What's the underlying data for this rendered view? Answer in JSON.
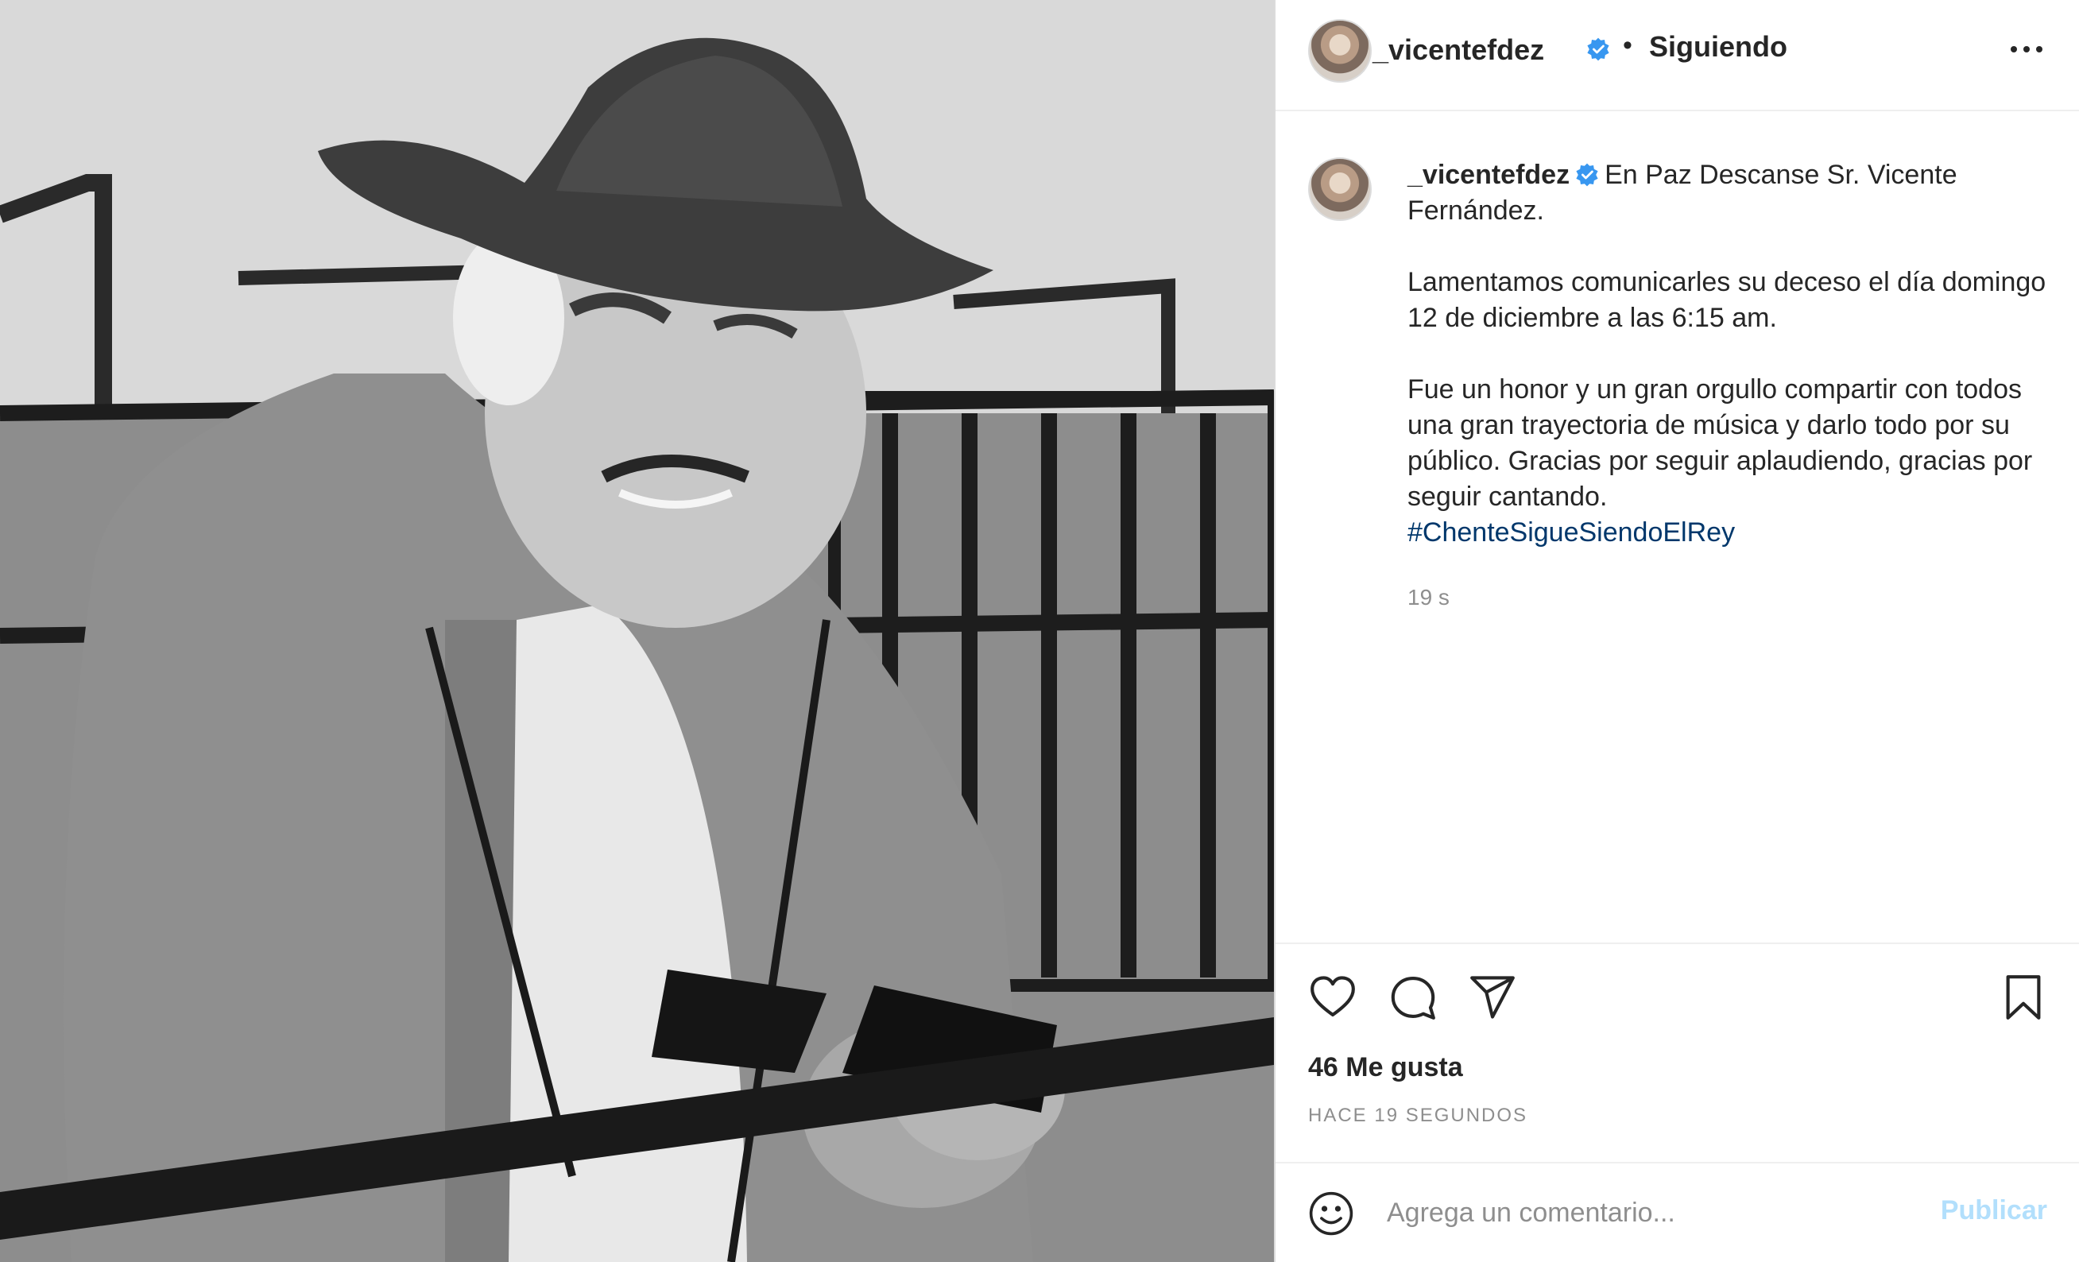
{
  "photo": {
    "alt": ""
  },
  "header": {
    "username": "_vicentefdez",
    "separator": "•",
    "follow_status": "Siguiendo"
  },
  "caption": {
    "username": "_vicentefdez",
    "line1": "En Paz Descanse Sr. Vicente Fernández.",
    "para2": "Lamentamos comunicarles su deceso el día domingo 12 de diciembre a las 6:15 am.",
    "para3": "Fue un honor y un gran orgullo compartir con todos una gran trayectoria de música y darlo todo por su público. Gracias por seguir aplaudiendo, gracias por seguir cantando.",
    "hashtag": "#ChenteSigueSiendoElRey",
    "time": "19 s"
  },
  "actions": {
    "icons": [
      "heart-icon",
      "comment-icon",
      "share-icon",
      "bookmark-icon"
    ],
    "likes": "46 Me gusta",
    "posted_ago": "HACE 19 SEGUNDOS"
  },
  "comment_box": {
    "placeholder": "Agrega un comentario...",
    "publish_label": "Publicar"
  },
  "colors": {
    "verified": "#3897f0",
    "hashtag": "#00376b",
    "publish_disabled": "#b2dffc",
    "muted": "#8e8e8e"
  }
}
